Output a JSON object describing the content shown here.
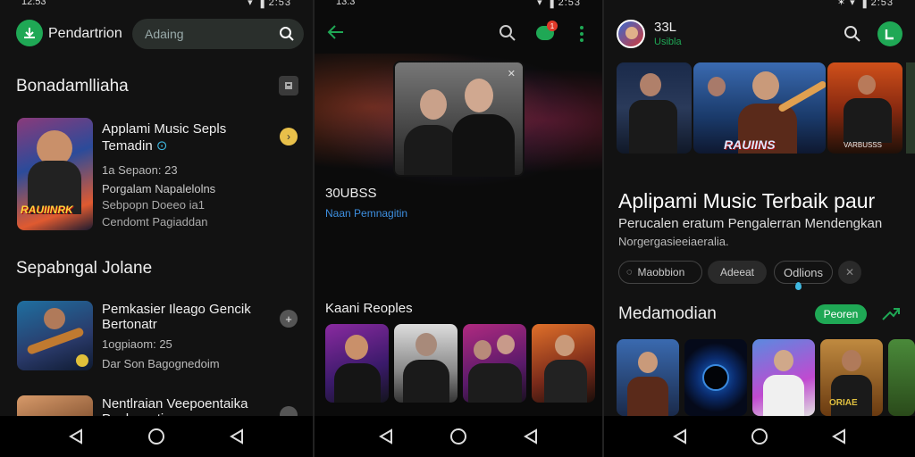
{
  "s1": {
    "status_time": "12:53",
    "status_right": "▾ ▐ 2:53",
    "app_name": "Pendartrion",
    "search_placeholder": "Adaing",
    "section1_title": "Bonadamlliaha",
    "track1": {
      "title": "Applami Music Sepls",
      "title2": "Temadin",
      "line1": "1a Sepaon: 23",
      "line2": "Porgalam Napalelolns",
      "line3": "Sebpopn Doeeo ia1",
      "line4": "Cendomt Pagiaddan",
      "poster_text": "RAUIINRK"
    },
    "section2_title": "Sepabngal Jolane",
    "track2": {
      "title": "Pemkasier Ileago Gencik",
      "title2": "Bertonatr",
      "line1": "1ogpiaom: 25",
      "line2": "Dar Son Bagognedoim"
    },
    "track3": {
      "title": "Nentlraian Veepoentaika",
      "title2": "Ponhnarrti"
    }
  },
  "s2": {
    "status_time": "13:3",
    "status_right": "▾ ▐ 2:53",
    "badge_count": "1",
    "count_label": "30UBSS",
    "artist_link": "Naan Pemnagitin",
    "section_title": "Kaani Reoples"
  },
  "s3": {
    "status_right": "✶ ▾ ▐ 2:53",
    "user_name": "33L",
    "user_sub": "Usibla",
    "banner_text": "RAUIINS",
    "banner_sub": "VARBUSSS",
    "headline": "Aplipami Music Terbaik paur",
    "subline": "Perucalen eratum Pengalerran Mendengkan",
    "subline2": "Norgergasieeiaeralia.",
    "chips": [
      "Maobbion",
      "Adeeat",
      "Odlions"
    ],
    "section_title": "Medamodian",
    "filter_label": "Peoren",
    "thumb_text": "ORIAE"
  },
  "colors": {
    "accent_green": "#1fa855",
    "link_blue": "#3d8fe0"
  }
}
